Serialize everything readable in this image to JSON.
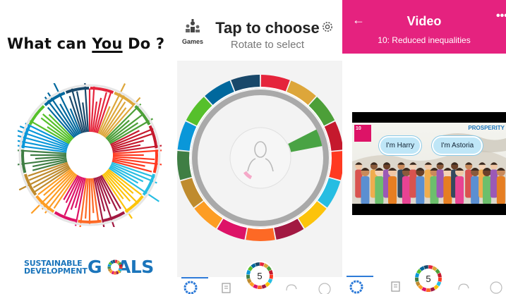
{
  "panel1": {
    "title_before": "What can ",
    "title_underlined": "You",
    "title_after": " Do ?",
    "logo_line1": "SUSTAINABLE",
    "logo_line2": "DEVELOPMENT",
    "logo_goals_g": "G",
    "logo_goals_rest": "ALS"
  },
  "panel2": {
    "games_label": "Games",
    "title": "Tap to choose",
    "subtitle": "Rotate to select",
    "nav": {
      "center_count": "5"
    }
  },
  "panel3": {
    "back_icon": "←",
    "title": "Video",
    "more_icon": "•••",
    "subtitle": "10: Reduced inequalities",
    "video": {
      "speaker1": "I'm Harry",
      "speaker2": "I'm Astoria",
      "banner": "PROSPERITY",
      "goal_badge": "10"
    },
    "nav": {
      "center_count": "5"
    }
  },
  "sdg_colors": [
    "#e5243b",
    "#dda63a",
    "#4c9f38",
    "#c5192d",
    "#ff3a21",
    "#26bde2",
    "#fcc30b",
    "#a21942",
    "#fd6925",
    "#dd1367",
    "#fd9d24",
    "#bf8b2e",
    "#3f7e44",
    "#0a97d9",
    "#56c02b",
    "#00689d",
    "#19486a"
  ],
  "icons": {
    "games": "games-trophy-icon",
    "settings": "gear-icon",
    "back": "arrow-left-icon",
    "more": "more-dots-icon",
    "nav_home": "sdg-wheel-icon",
    "nav_list": "document-icon",
    "nav_weather": "cloud-icon",
    "nav_profile": "person-icon"
  }
}
